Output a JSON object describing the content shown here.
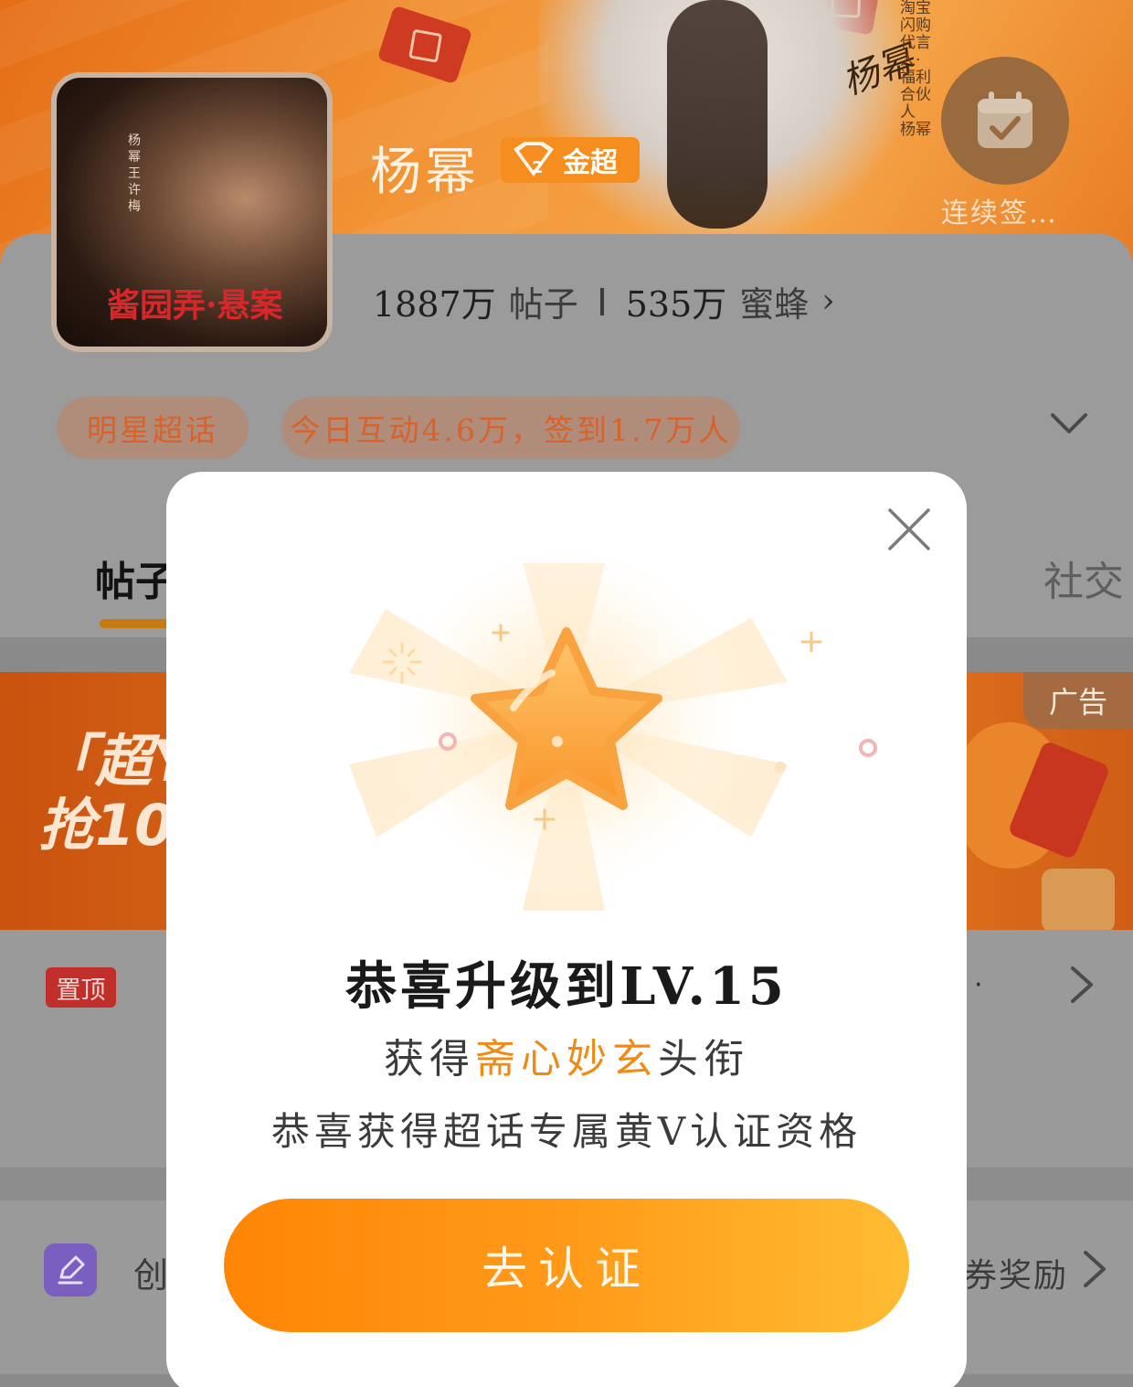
{
  "banner": {
    "star_name": "杨幂",
    "level_badge": "金超",
    "signature": "杨幂",
    "side_text": "淘宝闪购代言人·福利合伙人 杨幂",
    "checkin_label": "连续签…"
  },
  "poster": {
    "title": "酱园弄·悬案",
    "side_text": "杨幂 王许梅"
  },
  "stats": {
    "posts_count": "1887万",
    "posts_label": "帖子",
    "fans_count": "535万",
    "fans_label": "蜜蜂"
  },
  "pills": {
    "category": "明星超话",
    "activity": "今日互动4.6万，签到1.7万人"
  },
  "tabs": {
    "left": "帖子",
    "right": "社交"
  },
  "ad": {
    "line1": "「超Y",
    "line2": "抢10",
    "tag": "广告"
  },
  "pinned": {
    "tag": "置顶",
    "trailing": "·"
  },
  "create_row": {
    "label": "创",
    "reward": "券奖励"
  },
  "modal": {
    "title": "恭喜升级到LV.15",
    "line1_prefix": "获得",
    "line1_highlight": "斋心妙玄",
    "line1_suffix": "头衔",
    "line2": "恭喜获得超话专属黄V认证资格",
    "button": "去认证"
  },
  "colors": {
    "accent": "#f08a16",
    "button_start": "#ff8506",
    "button_end": "#ffbc33"
  }
}
